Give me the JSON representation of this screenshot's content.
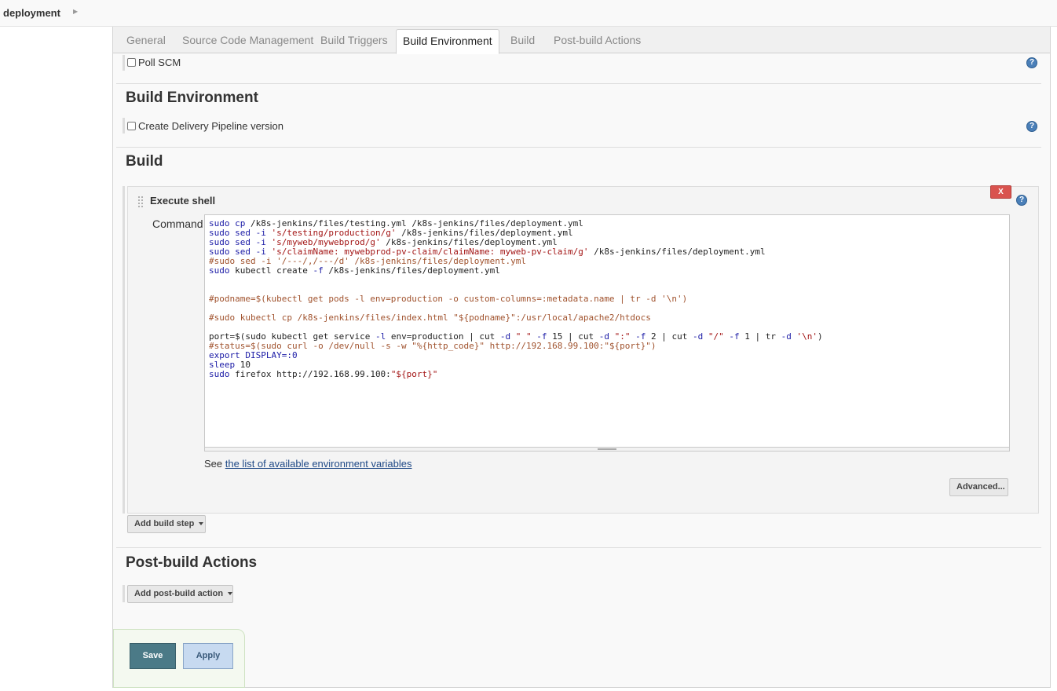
{
  "breadcrumb": {
    "item": "deployment"
  },
  "tabs": [
    {
      "label": "General"
    },
    {
      "label": "Source Code Management"
    },
    {
      "label": "Build Triggers"
    },
    {
      "label": "Build Environment",
      "active": true
    },
    {
      "label": "Build"
    },
    {
      "label": "Post-build Actions"
    }
  ],
  "triggers": {
    "poll_scm_label": "Poll SCM",
    "poll_scm_checked": false
  },
  "build_environment": {
    "title": "Build Environment",
    "delivery_pipeline_label": "Create Delivery Pipeline version",
    "delivery_pipeline_checked": false
  },
  "build": {
    "title": "Build",
    "step": {
      "title": "Execute shell",
      "delete_label": "X",
      "command_label": "Command",
      "command_lines": [
        "sudo cp /k8s-jenkins/files/testing.yml /k8s-jenkins/files/deployment.yml",
        "sudo sed -i 's/testing/production/g' /k8s-jenkins/files/deployment.yml",
        "sudo sed -i 's/myweb/mywebprod/g' /k8s-jenkins/files/deployment.yml",
        "sudo sed -i 's/claimName: mywebprod-pv-claim/claimName: myweb-pv-claim/g' /k8s-jenkins/files/deployment.yml",
        "#sudo sed -i '/---/,/---/d' /k8s-jenkins/files/deployment.yml",
        "sudo kubectl create -f /k8s-jenkins/files/deployment.yml",
        "",
        "",
        "#podname=$(kubectl get pods -l env=production -o custom-columns=:metadata.name | tr -d '\\n')",
        "",
        "#sudo kubectl cp /k8s-jenkins/files/index.html \"${podname}\":/usr/local/apache2/htdocs",
        "",
        "port=$(sudo kubectl get service -l env=production | cut -d \" \" -f 15 | cut -d \":\" -f 2 | cut -d \"/\" -f 1 | tr -d '\\n')",
        "#status=$(sudo curl -o /dev/null -s -w \"%{http_code}\" http://192.168.99.100:\"${port}\")",
        "export DISPLAY=:0",
        "sleep 10",
        "sudo firefox http://192.168.99.100:\"${port}\""
      ],
      "env_note_prefix": "See ",
      "env_link_text": "the list of available environment variables",
      "advanced_label": "Advanced..."
    },
    "add_step_label": "Add build step"
  },
  "post_build": {
    "title": "Post-build Actions",
    "add_action_label": "Add post-build action"
  },
  "footer": {
    "save_label": "Save",
    "apply_label": "Apply"
  },
  "help_icon_glyph": "?",
  "colors": {
    "save": "#4b7a87",
    "apply": "#c7daf0",
    "delete": "#d9534f",
    "link": "#204a87"
  }
}
